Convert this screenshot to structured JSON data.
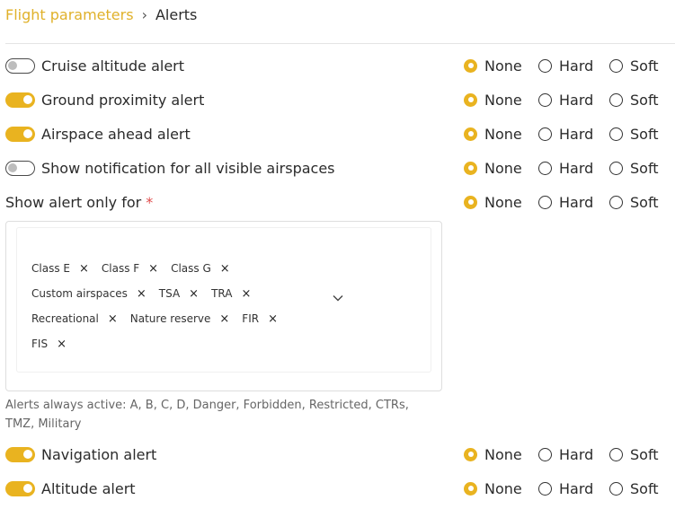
{
  "breadcrumb": {
    "parent": "Flight parameters",
    "separator": "›",
    "current": "Alerts"
  },
  "radio_labels": {
    "none": "None",
    "hard": "Hard",
    "soft": "Soft"
  },
  "alerts": [
    {
      "label": "Cruise altitude alert",
      "toggle": "off",
      "level": "None"
    },
    {
      "label": "Ground proximity alert",
      "toggle": "on",
      "level": "None"
    },
    {
      "label": "Airspace ahead alert",
      "toggle": "on",
      "level": "None"
    },
    {
      "label": "Show notification for all visible airspaces",
      "toggle": "off",
      "level": "None"
    },
    {
      "label": "Show alert only for",
      "required_mark": "*",
      "level": "None"
    },
    {
      "label": "Navigation alert",
      "toggle": "on",
      "level": "None"
    },
    {
      "label": "Altitude alert",
      "toggle": "on",
      "level": "None"
    }
  ],
  "airspace_select": {
    "tag_rows": [
      [
        "Class E",
        "Class F",
        "Class G"
      ],
      [
        "Custom airspaces",
        "TSA",
        "TRA"
      ],
      [
        "Recreational",
        "Nature reserve",
        "FIR"
      ],
      [
        "FIS"
      ]
    ],
    "remove_glyph": "×",
    "dropdown_icon": "chevron-down-icon"
  },
  "always_active_note": "Alerts always active: A, B, C, D, Danger, Forbidden, Restricted, CTRs, TMZ, Military",
  "colors": {
    "accent": "#e9b320",
    "link": "#e0b12a",
    "required": "#e04b4b"
  }
}
